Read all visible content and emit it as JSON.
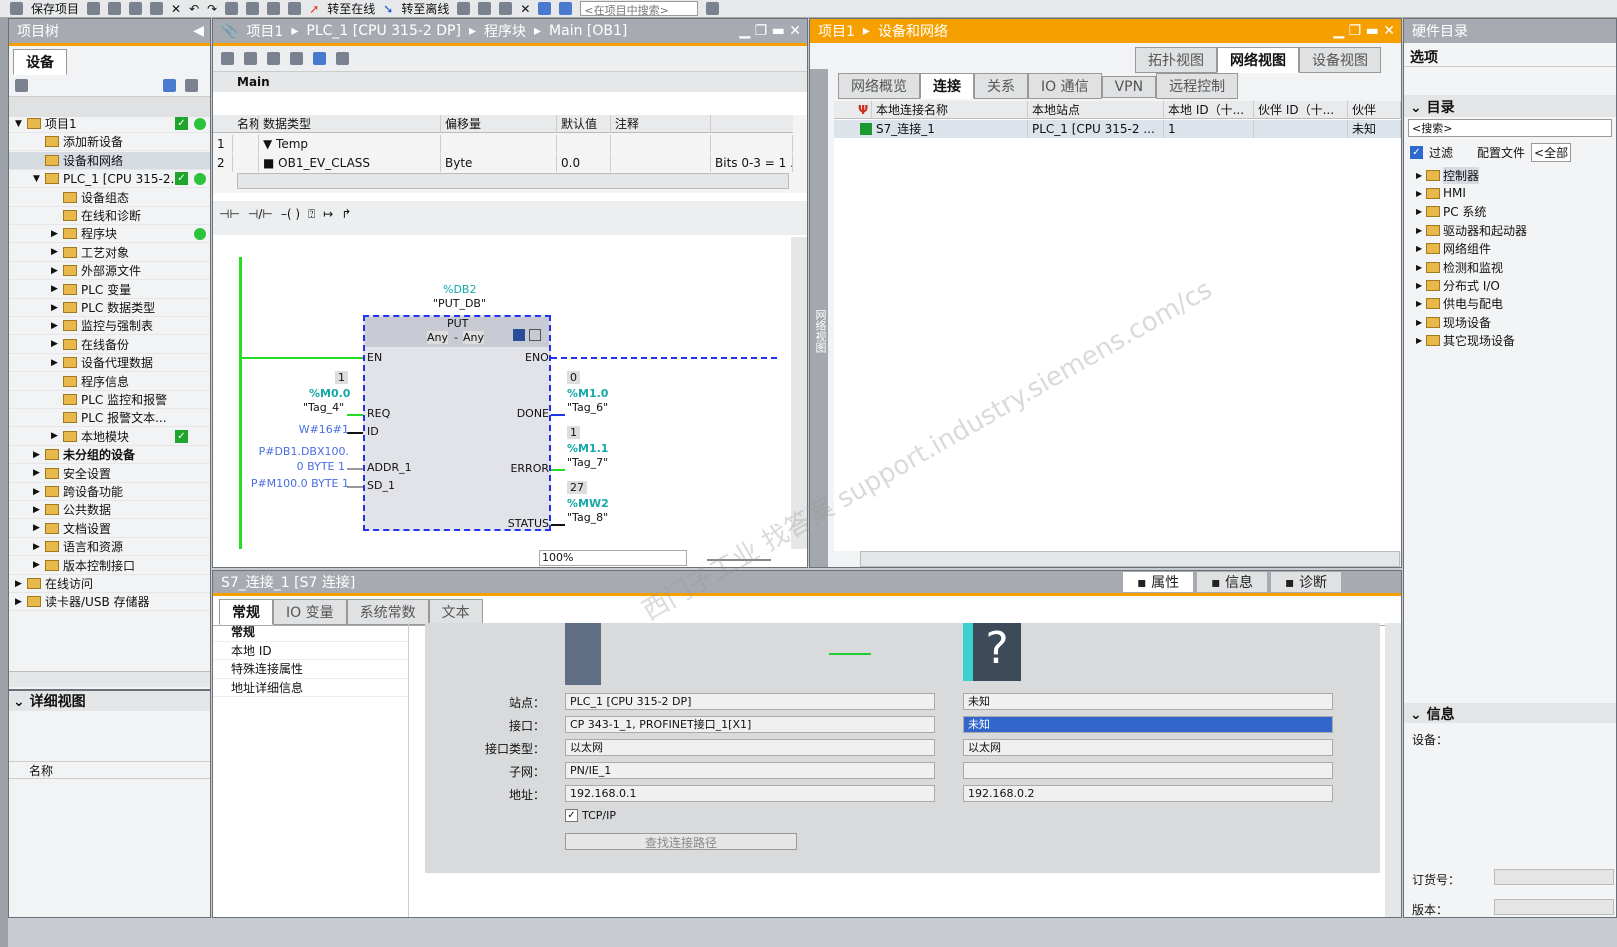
{
  "toolbar": {
    "save_label": "保存项目",
    "go_online": "转至在线",
    "go_offline": "转至离线",
    "search_placeholder": "<在项目中搜索>"
  },
  "project_tree": {
    "title": "项目树",
    "tab": "设备",
    "items": [
      {
        "label": "项目1",
        "level": 0,
        "exp": "▼",
        "chk": true,
        "dot": true
      },
      {
        "label": "添加新设备",
        "level": 1,
        "exp": ""
      },
      {
        "label": "设备和网络",
        "level": 1,
        "exp": "",
        "sel": true
      },
      {
        "label": "PLC_1 [CPU 315-2...",
        "level": 1,
        "exp": "▼",
        "chk": true,
        "dot": true
      },
      {
        "label": "设备组态",
        "level": 2,
        "exp": ""
      },
      {
        "label": "在线和诊断",
        "level": 2,
        "exp": ""
      },
      {
        "label": "程序块",
        "level": 2,
        "exp": "▶",
        "dot": true
      },
      {
        "label": "工艺对象",
        "level": 2,
        "exp": "▶"
      },
      {
        "label": "外部源文件",
        "level": 2,
        "exp": "▶"
      },
      {
        "label": "PLC 变量",
        "level": 2,
        "exp": "▶"
      },
      {
        "label": "PLC 数据类型",
        "level": 2,
        "exp": "▶"
      },
      {
        "label": "监控与强制表",
        "level": 2,
        "exp": "▶"
      },
      {
        "label": "在线备份",
        "level": 2,
        "exp": "▶"
      },
      {
        "label": "设备代理数据",
        "level": 2,
        "exp": "▶"
      },
      {
        "label": "程序信息",
        "level": 2,
        "exp": ""
      },
      {
        "label": "PLC 监控和报警",
        "level": 2,
        "exp": ""
      },
      {
        "label": "PLC 报警文本...",
        "level": 2,
        "exp": ""
      },
      {
        "label": "本地模块",
        "level": 2,
        "exp": "▶",
        "chk": true
      },
      {
        "label": "未分组的设备",
        "level": 1,
        "exp": "▶",
        "bold": true
      },
      {
        "label": "安全设置",
        "level": 1,
        "exp": "▶"
      },
      {
        "label": "跨设备功能",
        "level": 1,
        "exp": "▶"
      },
      {
        "label": "公共数据",
        "level": 1,
        "exp": "▶"
      },
      {
        "label": "文档设置",
        "level": 1,
        "exp": "▶"
      },
      {
        "label": "语言和资源",
        "level": 1,
        "exp": "▶"
      },
      {
        "label": "版本控制接口",
        "level": 1,
        "exp": "▶"
      },
      {
        "label": "在线访问",
        "level": 0,
        "exp": "▶"
      },
      {
        "label": "读卡器/USB 存储器",
        "level": 0,
        "exp": "▶"
      }
    ],
    "detail_title": "详细视图",
    "detail_col": "名称"
  },
  "editor": {
    "breadcrumb": [
      "项目1",
      "PLC_1 [CPU 315-2 DP]",
      "程序块",
      "Main [OB1]"
    ],
    "block_name": "Main",
    "columns": [
      "名称",
      "数据类型",
      "偏移量",
      "默认值",
      "注释"
    ],
    "rows": [
      {
        "n": "1",
        "name": "Temp",
        "type": "",
        "offset": "",
        "default": "",
        "comment": ""
      },
      {
        "n": "2",
        "name": "OB1_EV_CLASS",
        "type": "Byte",
        "offset": "0.0",
        "default": "",
        "comment": "Bits 0-3 = 1 ..."
      }
    ],
    "zoom": "100%",
    "ladder": {
      "db_addr": "%DB2",
      "db_name": "\"PUT_DB\"",
      "block": "PUT",
      "any1": "Any",
      "dash": "-",
      "any2": "Any",
      "en": "EN",
      "eno": "ENO",
      "inputs": [
        {
          "pin": "REQ",
          "val": "1",
          "addr": "%M0.0",
          "tag": "\"Tag_4\""
        },
        {
          "pin": "ID",
          "const": "W#16#1"
        },
        {
          "pin": "ADDR_1",
          "const": "P#DB1.DBX100.",
          "const2": "0 BYTE 1"
        },
        {
          "pin": "SD_1",
          "const": "P#M100.0 BYTE 1"
        }
      ],
      "outputs": [
        {
          "pin": "DONE",
          "val": "0",
          "addr": "%M1.0",
          "tag": "\"Tag_6\""
        },
        {
          "pin": "ERROR",
          "val": "1",
          "addr": "%M1.1",
          "tag": "\"Tag_7\""
        },
        {
          "pin": "STATUS",
          "val": "27",
          "addr": "%MW2",
          "tag": "\"Tag_8\""
        }
      ]
    }
  },
  "network": {
    "breadcrumb": [
      "项目1",
      "设备和网络"
    ],
    "views": [
      "拓扑视图",
      "网络视图",
      "设备视图"
    ],
    "tabs": [
      "网络概览",
      "连接",
      "关系",
      "IO 通信",
      "VPN",
      "远程控制"
    ],
    "active_tab": "连接",
    "columns": [
      "本地连接名称",
      "本地站点",
      "本地 ID（十...",
      "伙伴 ID（十...",
      "伙伴"
    ],
    "rows": [
      {
        "name": "S7_连接_1",
        "station": "PLC_1 [CPU 315-2 ...",
        "local_id": "1",
        "partner_id": "",
        "partner": "未知"
      }
    ],
    "side_label": "网络视图"
  },
  "catalog": {
    "title": "硬件目录",
    "options": "选项",
    "section": "目录",
    "search": "<搜索>",
    "filter": "过滤",
    "profile": "配置文件",
    "profile_value": "<全部",
    "items": [
      "控制器",
      "HMI",
      "PC 系统",
      "驱动器和起动器",
      "网络组件",
      "检测和监视",
      "分布式 I/O",
      "供电与配电",
      "现场设备",
      "其它现场设备"
    ],
    "info_title": "信息",
    "device_label": "设备：",
    "order_label": "订货号：",
    "version_label": "版本："
  },
  "inspector": {
    "title": "S7_连接_1 [S7 连接]",
    "right_tabs": [
      "属性",
      "信息",
      "诊断"
    ],
    "tabs": [
      "常规",
      "IO 变量",
      "系统常数",
      "文本"
    ],
    "nav": [
      "常规",
      "本地 ID",
      "特殊连接属性",
      "地址详细信息"
    ],
    "labels": [
      "站点：",
      "接口：",
      "接口类型：",
      "子网：",
      "地址："
    ],
    "local": [
      "PLC_1 [CPU 315-2 DP]",
      "CP 343-1_1, PROFINET接口_1[X1]",
      "以太网",
      "PN/IE_1",
      "192.168.0.1"
    ],
    "partner": [
      "未知",
      "未知",
      "以太网",
      "",
      "192.168.0.2"
    ],
    "tcpip": "TCP/IP",
    "find_path": "查找连接路径"
  },
  "watermark": "西门子工业 找答案 support.industry.siemens.com/cs"
}
